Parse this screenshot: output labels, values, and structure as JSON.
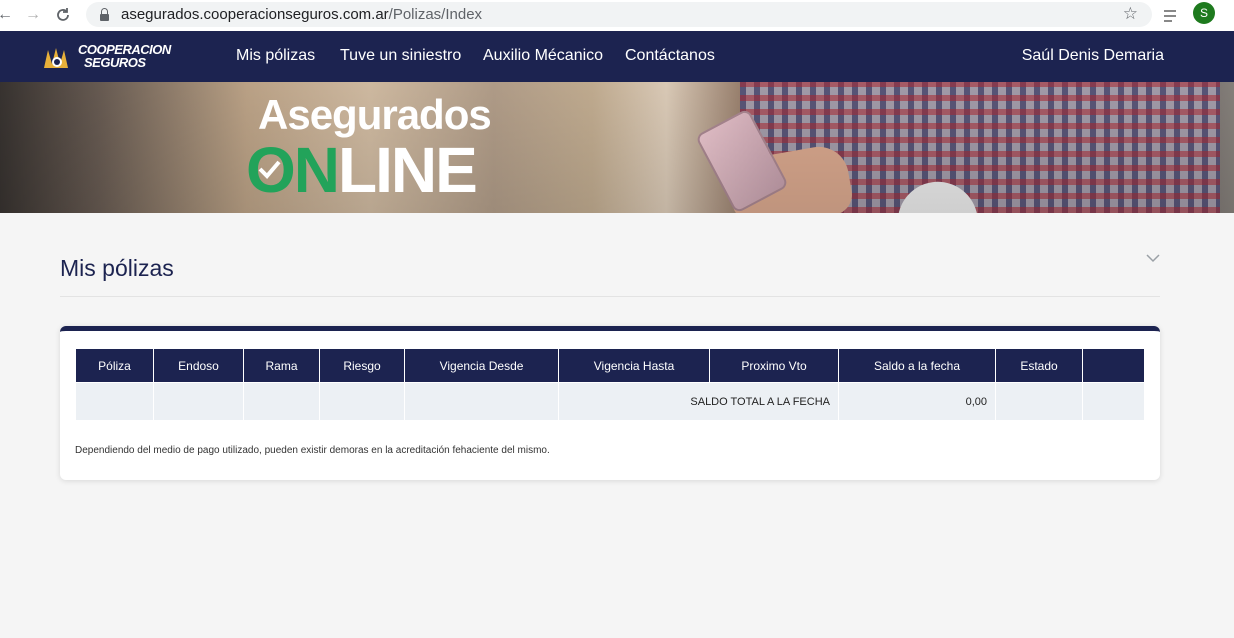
{
  "browser": {
    "url_domain": "asegurados.cooperacionseguros.com.ar",
    "url_path": "/Polizas/Index",
    "profile_initial": "S",
    "icons": [
      "back-arrow-icon",
      "forward-arrow-icon",
      "reload-icon",
      "lock-icon",
      "star-icon",
      "reading-list-icon"
    ]
  },
  "site": {
    "logo_line1": "COOPERACION",
    "logo_line2": "SEGUROS",
    "nav": [
      "Mis pólizas",
      "Tuve un siniestro",
      "Auxilio Mécanico",
      "Contáctanos"
    ],
    "user": "Saúl Denis Demaria"
  },
  "banner": {
    "title": "Asegurados",
    "online_on": "ON",
    "online_line": "LINE"
  },
  "main": {
    "title": "Mis pólizas",
    "table": {
      "headers": [
        "Póliza",
        "Endoso",
        "Rama",
        "Riesgo",
        "Vigencia Desde",
        "Vigencia Hasta",
        "Proximo Vto",
        "Saldo a la fecha",
        "Estado",
        ""
      ],
      "total_label": "SALDO TOTAL A LA FECHA",
      "total_value": "0,00"
    },
    "note": "Dependiendo del medio de pago utilizado, pueden existir demoras en la acreditación fehaciente del mismo."
  },
  "colors": {
    "navy": "#1c2350",
    "green": "#22a35a"
  }
}
